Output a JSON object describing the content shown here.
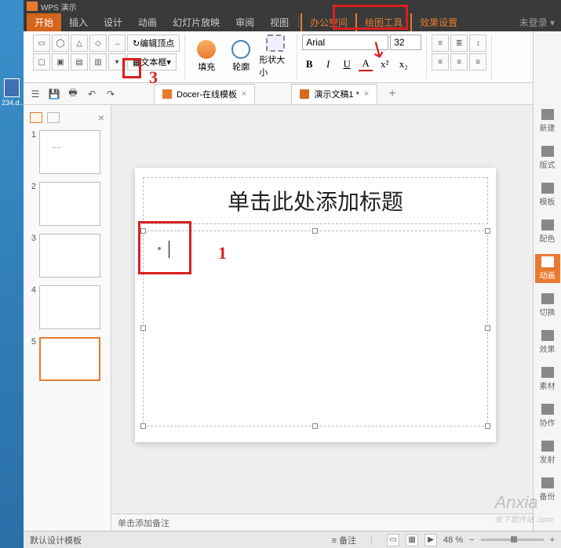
{
  "desktop": {
    "file_label": "234.d..."
  },
  "titlebar": {
    "app": "WPS 演示",
    "doc": "演示文稿1"
  },
  "menus": [
    "开始",
    "插入",
    "设计",
    "动画",
    "幻灯片放映",
    "审阅",
    "视图",
    "办公空间",
    "绘图工具",
    "效果设置"
  ],
  "menu_right": "未登录 ▾",
  "ribbon": {
    "edit_vertex": "编辑顶点",
    "textbox": "文本框",
    "fill": "填充",
    "outline": "轮廓",
    "shapesize": "形状大小",
    "font_name": "Arial",
    "font_size": "32",
    "bold": "B",
    "italic": "I",
    "underline": "U",
    "fontcolor": "A",
    "sup": "x²",
    "sub": "x₂"
  },
  "doc_tabs": {
    "tab1": "Docer-在线模板",
    "tab2": "演示文稿1 *",
    "add": "+"
  },
  "thumbs": {
    "count": 5,
    "selected": 5
  },
  "slide": {
    "title_placeholder": "单击此处添加标题"
  },
  "notes": {
    "placeholder": "单击添加备注"
  },
  "status": {
    "template": "默认设计模板",
    "notes_btn": "≡ 备注",
    "zoom": "48 %"
  },
  "side_panel": [
    "新建",
    "版式",
    "模板",
    "配色",
    "动画",
    "切换",
    "效果",
    "素材",
    "协作",
    "发射",
    "备份"
  ],
  "side_active": 4,
  "annotations": {
    "label1": "1",
    "label3": "3"
  },
  "watermark": {
    "main": "Anxia",
    "sub": "安下软件站 .com"
  }
}
